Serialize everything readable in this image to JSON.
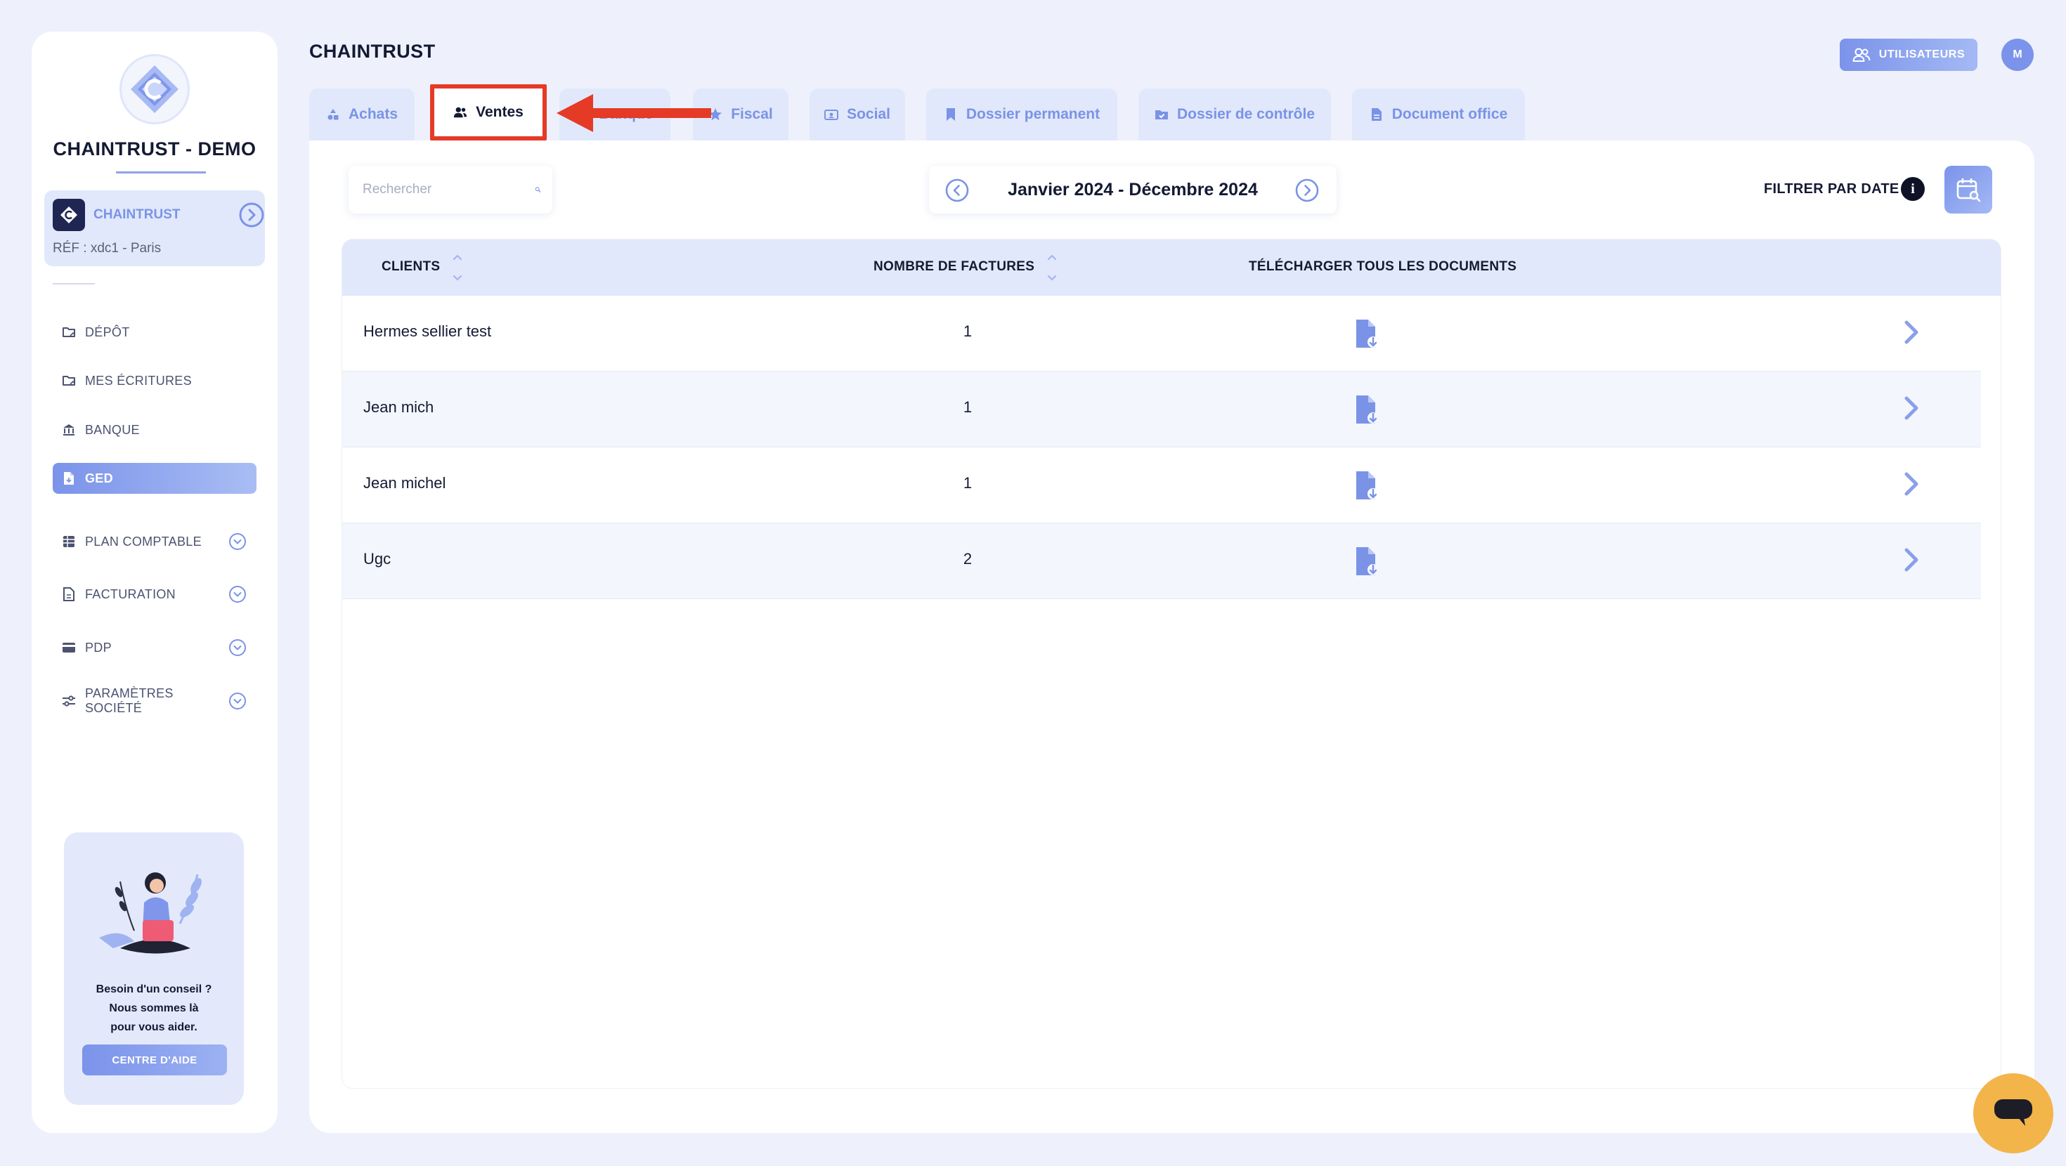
{
  "sidebar": {
    "brand": "CHAINTRUST - DEMO",
    "company": {
      "name": "CHAINTRUST",
      "ref": "RÉF : xdc1 - Paris"
    },
    "nav": [
      {
        "label": "DÉPÔT",
        "icon": "folder-icon",
        "active": false,
        "expandable": false
      },
      {
        "label": "MES ÉCRITURES",
        "icon": "folder-icon",
        "active": false,
        "expandable": false
      },
      {
        "label": "BANQUE",
        "icon": "bank-icon",
        "active": false,
        "expandable": false
      },
      {
        "label": "GED",
        "icon": "document-icon",
        "active": true,
        "expandable": false
      },
      {
        "label": "PLAN COMPTABLE",
        "icon": "table-icon",
        "active": false,
        "expandable": true
      },
      {
        "label": "FACTURATION",
        "icon": "invoice-icon",
        "active": false,
        "expandable": true
      },
      {
        "label": "PDP",
        "icon": "card-icon",
        "active": false,
        "expandable": true
      },
      {
        "label": "PARAMÈTRES SOCIÉTÉ",
        "icon": "sliders-icon",
        "active": false,
        "expandable": true
      }
    ],
    "help": {
      "line1": "Besoin d'un conseil ?",
      "line2": "Nous sommes là",
      "line3": "pour vous aider.",
      "button": "CENTRE D'AIDE"
    }
  },
  "header": {
    "title": "CHAINTRUST",
    "users_button": "UTILISATEURS",
    "avatar_initial": "M"
  },
  "tabs": [
    {
      "label": "Achats",
      "icon": "shapes-icon",
      "active": false
    },
    {
      "label": "Ventes",
      "icon": "users-icon",
      "active": true
    },
    {
      "label": "Banque",
      "icon": "bank-icon",
      "active": false
    },
    {
      "label": "Fiscal",
      "icon": "star-icon",
      "active": false
    },
    {
      "label": "Social",
      "icon": "id-card-icon",
      "active": false
    },
    {
      "label": "Dossier permanent",
      "icon": "bookmark-icon",
      "active": false
    },
    {
      "label": "Dossier de contrôle",
      "icon": "folder-check-icon",
      "active": false
    },
    {
      "label": "Document office",
      "icon": "file-icon",
      "active": false
    }
  ],
  "toolbar": {
    "search_placeholder": "Rechercher",
    "date_range": "Janvier 2024 - Décembre 2024",
    "filter_label": "FILTRER PAR DATE",
    "info_glyph": "i"
  },
  "table": {
    "headers": {
      "clients": "CLIENTS",
      "count": "NOMBRE DE FACTURES",
      "download": "TÉLÉCHARGER TOUS LES DOCUMENTS"
    },
    "rows": [
      {
        "client": "Hermes sellier test",
        "count": "1"
      },
      {
        "client": "Jean mich",
        "count": "1"
      },
      {
        "client": "Jean michel",
        "count": "1"
      },
      {
        "client": "Ugc",
        "count": "2"
      }
    ]
  },
  "colors": {
    "accent": "#7a93e6",
    "background": "#eef1fb",
    "annotation": "#e53a26",
    "chat": "#f3b44a"
  }
}
